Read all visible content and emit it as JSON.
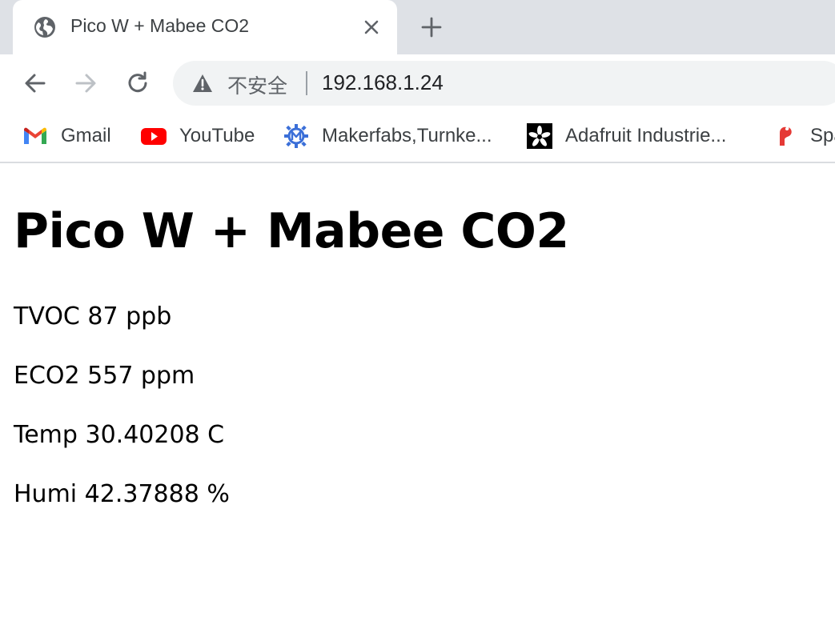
{
  "tab": {
    "title": "Pico W + Mabee CO2",
    "icon": "globe-icon",
    "close_icon": "close-icon"
  },
  "toolbar": {
    "back_icon": "back-arrow-icon",
    "forward_icon": "forward-arrow-icon",
    "reload_icon": "reload-icon",
    "security_label": "不安全",
    "url": "192.168.1.24"
  },
  "bookmarks": [
    {
      "label": "Gmail",
      "icon": "gmail-icon"
    },
    {
      "label": "YouTube",
      "icon": "youtube-icon"
    },
    {
      "label": "Makerfabs,Turnke...",
      "icon": "makerfabs-icon"
    },
    {
      "label": "Adafruit Industrie...",
      "icon": "adafruit-icon"
    },
    {
      "label": "Spa",
      "icon": "sparkfun-icon"
    }
  ],
  "page": {
    "title": "Pico W + Mabee CO2",
    "readings": [
      {
        "text": "TVOC 87 ppb"
      },
      {
        "text": "ECO2 557 ppm"
      },
      {
        "text": "Temp 30.40208 C"
      },
      {
        "text": "Humi 42.37888 %"
      }
    ]
  },
  "colors": {
    "tabstrip_bg": "#dee1e6",
    "omnibox_bg": "#f1f3f4",
    "youtube_red": "#ff0000",
    "makerfabs_blue": "#3b6fd8"
  }
}
